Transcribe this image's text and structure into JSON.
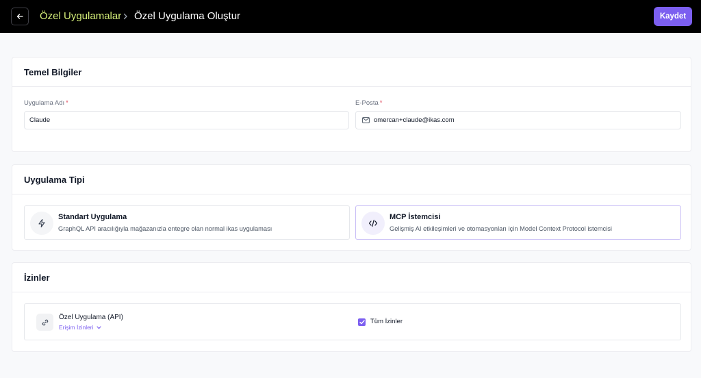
{
  "header": {
    "breadcrumb_parent": "Özel Uygulamalar",
    "breadcrumb_current": "Özel Uygulama Oluştur",
    "save_label": "Kaydet",
    "accent_color": "#7c5ff0",
    "breadcrumb_color": "#d6f07a"
  },
  "basic_info": {
    "title": "Temel Bilgiler",
    "app_name_label": "Uygulama Adı",
    "app_name_value": "Claude",
    "email_label": "E-Posta",
    "email_value": "omercan+claude@ikas.com",
    "required_mark": "*",
    "email_icon": "mail-icon"
  },
  "app_type": {
    "title": "Uygulama Tipi",
    "options": [
      {
        "title": "Standart Uygulama",
        "description": "GraphQL API aracılığıyla mağazanızla entegre olan normal ikas uygulaması",
        "icon": "lightning-icon",
        "selected": false
      },
      {
        "title": "MCP İstemcisi",
        "description": "Gelişmiş AI etkileşimleri ve otomasyonları için Model Context Protocol istemcisi",
        "icon": "code-icon",
        "selected": true
      }
    ]
  },
  "permissions": {
    "title": "İzinler",
    "item_title": "Özel Uygulama (API)",
    "access_link": "Erişim İzinleri",
    "all_permissions_label": "Tüm İzinler",
    "all_permissions_checked": true,
    "item_icon": "link-icon"
  }
}
